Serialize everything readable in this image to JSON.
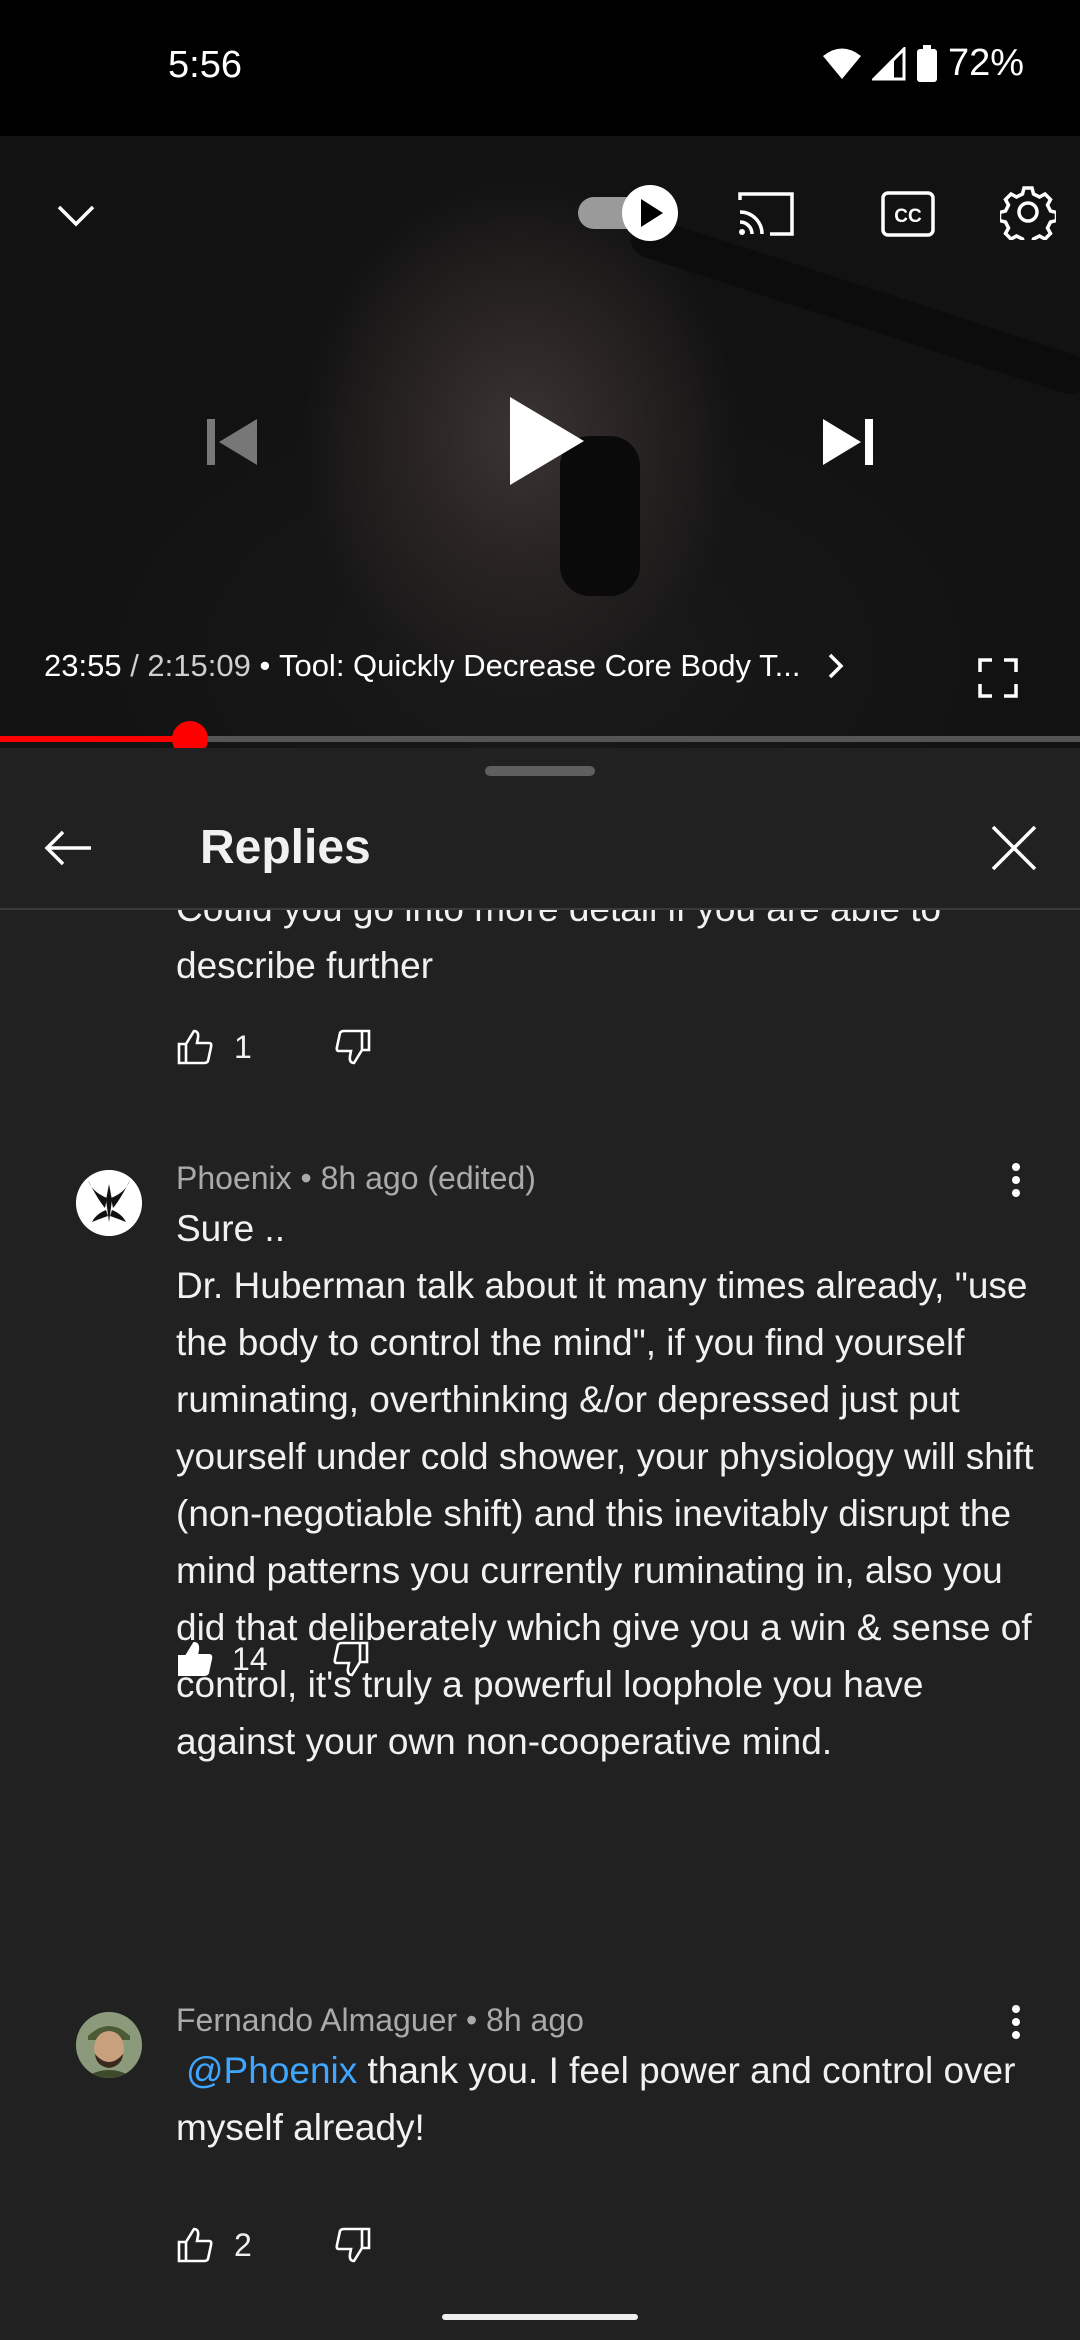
{
  "status_bar": {
    "time": "5:56",
    "battery": "72%"
  },
  "player": {
    "time_current": "23:55",
    "time_sep": " / ",
    "time_total": "2:15:09",
    "title_sep": " • ",
    "video_title": "Tool: Quickly Decrease Core Body T...",
    "progress_fraction": 0.176
  },
  "sheet": {
    "title": "Replies"
  },
  "comments": [
    {
      "text": "Could you go into more detail if you are able to\ndescribe further",
      "likes": "1"
    },
    {
      "author": "Phoenix",
      "meta_rest": " • 8h ago (edited)",
      "text": "Sure ..\nDr. Huberman talk about it many times already, \"use the body to control the mind\", if you find yourself ruminating, overthinking &/or depressed just put yourself under cold shower, your physiology will shift (non-negotiable shift) and this inevitably disrupt the mind patterns you currently ruminating in, also you did that deliberately which give you a win & sense of control, it's truly a powerful loophole you have against your own non-cooperative mind.",
      "likes": "14",
      "liked": true
    },
    {
      "author": "Fernando Almaguer",
      "meta_rest": " • 8h ago",
      "mention": "@Phoenix",
      "text": " thank you. I feel power and control over myself already!",
      "likes": "2"
    }
  ],
  "icons": [
    "chevron-down-icon",
    "autoplay-toggle-icon",
    "cast-icon",
    "cc-icon",
    "settings-icon",
    "previous-icon",
    "play-icon",
    "next-icon",
    "fullscreen-icon",
    "back-arrow-icon",
    "close-icon",
    "like-icon",
    "dislike-icon",
    "more-vert-icon"
  ]
}
